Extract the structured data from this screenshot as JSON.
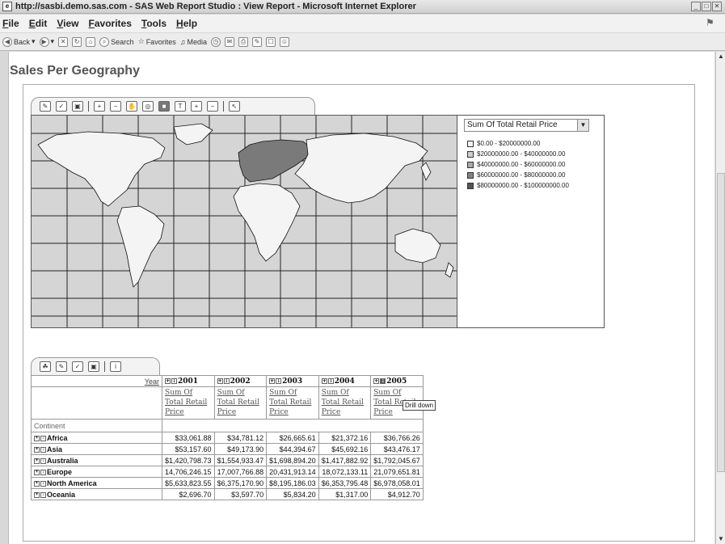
{
  "window": {
    "title": "http://sasbi.demo.sas.com - SAS Web Report Studio : View Report - Microsoft Internet Explorer"
  },
  "menu": [
    "File",
    "Edit",
    "View",
    "Favorites",
    "Tools",
    "Help"
  ],
  "toolbar": {
    "back": "Back",
    "search": "Search",
    "favorites": "Favorites",
    "media": "Media"
  },
  "report": {
    "title": "Sales Per Geography",
    "legend": {
      "measure": "Sum Of Total Retail Price",
      "ranges": [
        {
          "label": "$0.00 - $20000000.00",
          "color": "#f2f2f2"
        },
        {
          "label": "$20000000.00 - $40000000.00",
          "color": "#cfcfcf"
        },
        {
          "label": "$40000000.00 - $60000000.00",
          "color": "#a9a9a9"
        },
        {
          "label": "$60000000.00 - $80000000.00",
          "color": "#838383"
        },
        {
          "label": "$80000000.00 - $100000000.00",
          "color": "#555555"
        }
      ]
    },
    "table": {
      "year_label": "Year",
      "row_header": "Continent",
      "years": [
        "2001",
        "2002",
        "2003",
        "2004",
        "2005"
      ],
      "measure_lines": [
        "Sum Of",
        "Total Retail",
        "Price"
      ],
      "rows": [
        {
          "name": "Africa",
          "values": [
            "$33,061.88",
            "$34,781.12",
            "$26,665.61",
            "$21,372.16",
            "$36,766.26"
          ]
        },
        {
          "name": "Asia",
          "values": [
            "$53,157.60",
            "$49,173.90",
            "$44,394.67",
            "$45,692.16",
            "$43,476.17"
          ]
        },
        {
          "name": "Australia",
          "values": [
            "$1,420,798.73",
            "$1,554,933.47",
            "$1,698,894.20",
            "$1,417,882.92",
            "$1,792,045.67"
          ]
        },
        {
          "name": "Europe",
          "values": [
            "14,706,246.15",
            "17,007,766.88",
            "20,431,913.14",
            "18,072,133.11",
            "21,079,651.81"
          ]
        },
        {
          "name": "North America",
          "values": [
            "$5,633,823.55",
            "$6,375,170.90",
            "$8,195,186.03",
            "$6,353,795.48",
            "$6,978,058.01"
          ]
        },
        {
          "name": "Oceania",
          "values": [
            "$2,696.70",
            "$3,597.70",
            "$5,834.20",
            "$1,317.00",
            "$4,912.70"
          ]
        }
      ],
      "tooltip": "Drill down"
    }
  }
}
